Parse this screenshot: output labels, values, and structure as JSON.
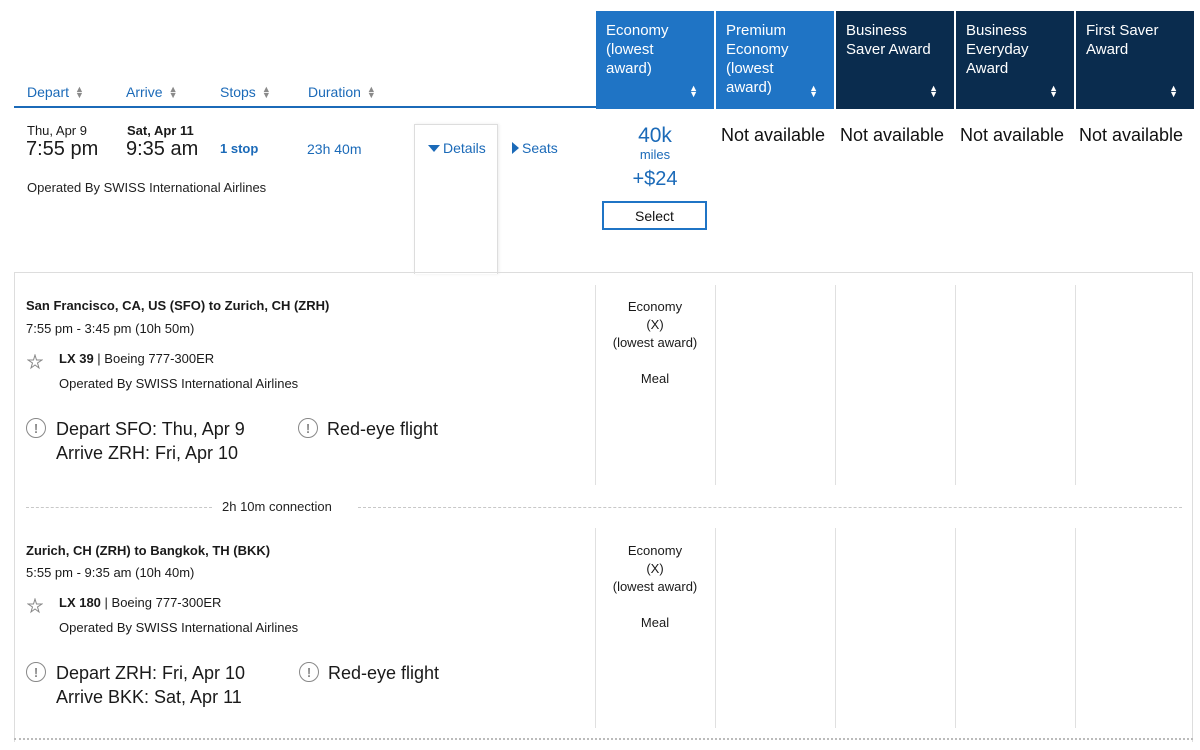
{
  "header": {
    "sort_columns": [
      {
        "label": "Depart"
      },
      {
        "label": "Arrive"
      },
      {
        "label": "Stops"
      },
      {
        "label": "Duration"
      }
    ],
    "cabins": [
      {
        "label": "Economy (lowest award)",
        "line1": "Economy",
        "line2": "(lowest",
        "line3": "award)",
        "active": true
      },
      {
        "label": "Premium Economy (lowest award)",
        "line1": "Premium",
        "line2": "Economy",
        "line3": "(lowest",
        "line4": "award)",
        "active": false
      },
      {
        "label": "Business Saver Award",
        "line1": "Business",
        "line2": "Saver Award",
        "active": false
      },
      {
        "label": "Business Everyday Award",
        "line1": "Business",
        "line2": "Everyday",
        "line3": "Award",
        "active": false
      },
      {
        "label": "First Saver Award",
        "line1": "First Saver",
        "line2": "Award",
        "active": false
      }
    ],
    "colors": {
      "active_cabin": "#1f74c5",
      "dark_cabin": "#0a2c4e",
      "link": "#1b6ab8"
    }
  },
  "flight": {
    "depart_date": "Thu, Apr 9",
    "depart_time": "7:55 pm",
    "arrive_date": "Sat, Apr 11",
    "arrive_time": "9:35 am",
    "stops": "1 stop",
    "duration": "23h 40m",
    "operated_by": "Operated By SWISS International Airlines",
    "details_label": "Details",
    "seats_label": "Seats",
    "economy_price": {
      "miles": "40k",
      "unit": "miles",
      "fee": "+$24",
      "select_label": "Select"
    },
    "not_available": "Not available"
  },
  "segments": [
    {
      "route": "San Francisco, CA, US (SFO) to Zurich, CH (ZRH)",
      "times": "7:55 pm - 3:45 pm (10h 50m)",
      "flight_no": "LX 39",
      "aircraft": " | Boeing 777-300ER",
      "operated_by": "Operated By SWISS International Airlines",
      "alert_depart": "Depart SFO: Thu, Apr 9",
      "alert_arrive": "Arrive ZRH: Fri, Apr 10",
      "alert_redeye": "Red-eye flight",
      "cabin_line1": "Economy",
      "cabin_line2": "(X)",
      "cabin_line3": "(lowest award)",
      "meal": "Meal"
    },
    {
      "route": "Zurich, CH (ZRH) to Bangkok, TH (BKK)",
      "times": "5:55 pm - 9:35 am (10h 40m)",
      "flight_no": "LX 180",
      "aircraft": " | Boeing 777-300ER",
      "operated_by": "Operated By SWISS International Airlines",
      "alert_depart": "Depart ZRH: Fri, Apr 10",
      "alert_arrive": "Arrive BKK: Sat, Apr 11",
      "alert_redeye": "Red-eye flight",
      "cabin_line1": "Economy",
      "cabin_line2": "(X)",
      "cabin_line3": "(lowest award)",
      "meal": "Meal"
    }
  ],
  "connection": "2h 10m connection"
}
